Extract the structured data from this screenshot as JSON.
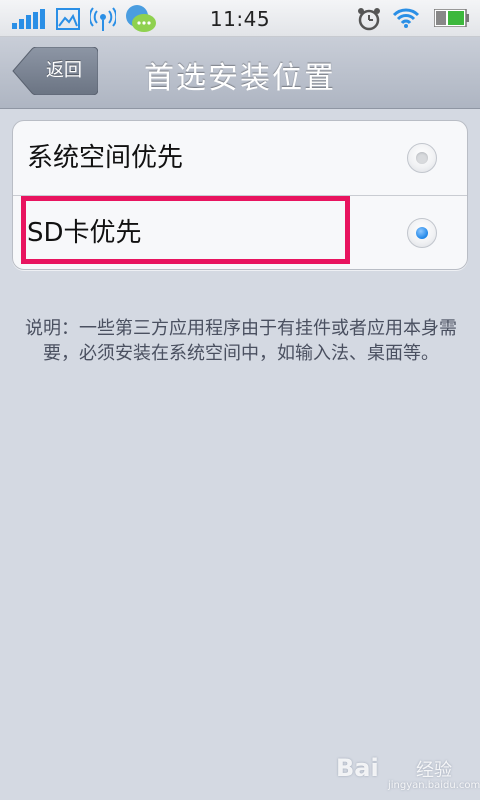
{
  "status_bar": {
    "time": "11:45",
    "icons": [
      "signal-icon",
      "image-icon",
      "hotspot-icon",
      "chat-bubble-icon",
      "alarm-icon",
      "wifi-icon",
      "battery-icon"
    ]
  },
  "header": {
    "back_label": "返回",
    "title": "首选安装位置"
  },
  "options": [
    {
      "label": "系统空间优先",
      "selected": false
    },
    {
      "label": "SD卡优先",
      "selected": true
    }
  ],
  "description": "说明：一些第三方应用程序由于有挂件或者应用本身需要，必须安装在系统空间中，如输入法、桌面等。",
  "watermark": {
    "brand": "Bai",
    "suffix": "经验",
    "url": "jingyan.baidu.com"
  },
  "colors": {
    "highlight": "#e8145f",
    "radio_selected": "#1f86e8",
    "background": "#d4d9e2"
  }
}
